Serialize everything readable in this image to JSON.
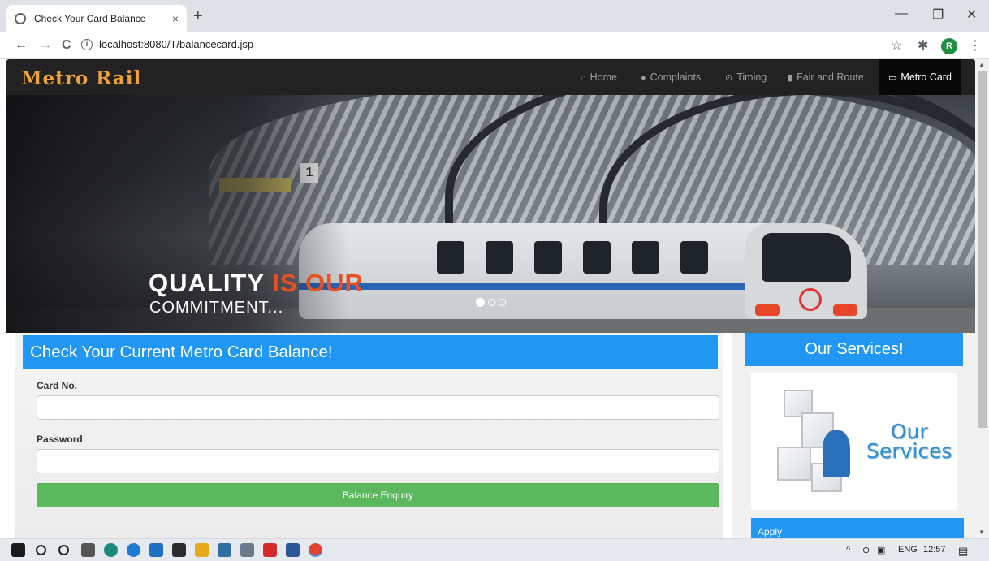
{
  "browser": {
    "tab_title": "Check Your Card Balance",
    "tab_close": "×",
    "new_tab": "+",
    "url": "localhost:8080/T/balancecard.jsp",
    "profile_initial": "R",
    "minimize": "—",
    "restore": "❐",
    "close": "✕",
    "back": "←",
    "forward": "→",
    "reload": "C",
    "info": "i",
    "star": "☆",
    "extensions": "✱",
    "menu": "⋮"
  },
  "navbar": {
    "brand": "Metro Rail",
    "items": [
      {
        "label": "Home",
        "icon": "⌂"
      },
      {
        "label": "Complaints",
        "icon": "●"
      },
      {
        "label": "Timing",
        "icon": "⊙"
      },
      {
        "label": "Fair and Route",
        "icon": "▮"
      },
      {
        "label": "Metro Card",
        "icon": "▭"
      }
    ],
    "active_index": 4
  },
  "hero": {
    "caption_a": "QUALITY",
    "caption_b": "IS OUR",
    "caption_c": "COMMITMENT...",
    "sign_number": "1",
    "slides": 3,
    "active_slide": 0
  },
  "form": {
    "heading": "Check Your Current Metro Card Balance!",
    "card_label": "Card No.",
    "card_value": "",
    "card_placeholder": "",
    "password_label": "Password",
    "password_value": "",
    "password_placeholder": "",
    "submit_label": "Balance Enquiry"
  },
  "sidebar": {
    "heading": "Our Services!",
    "image_text_1": "Our",
    "image_text_2": "Services",
    "apply_label": "Apply"
  },
  "taskbar": {
    "tray_caret": "^",
    "language": "ENG",
    "time": "12:57"
  },
  "colors": {
    "accent_blue": "#2196f3",
    "submit_green": "#5cb85c",
    "brand_orange": "#f0a23a",
    "navbar_dark": "#222222"
  }
}
